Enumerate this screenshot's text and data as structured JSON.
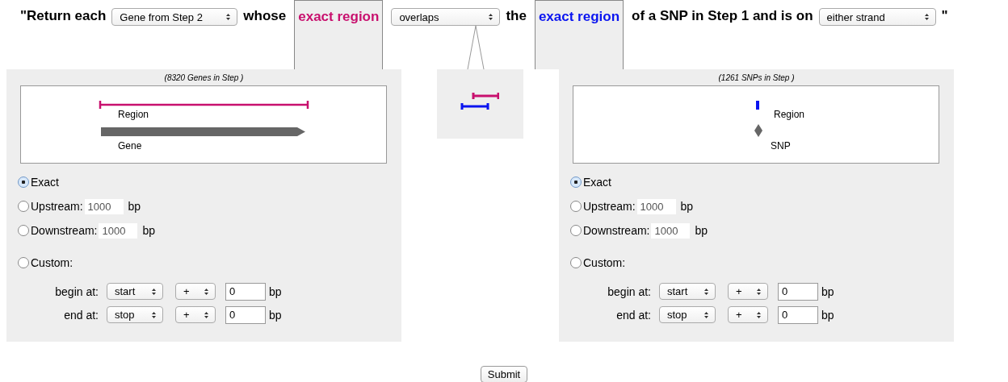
{
  "sentence": [
    {
      "kind": "text",
      "text": "\"Return each"
    },
    {
      "kind": "select",
      "value": "Gene from Step 2"
    },
    {
      "kind": "text",
      "text": "whose"
    },
    {
      "kind": "region",
      "text": "exact region",
      "color": "#c8106e"
    },
    {
      "kind": "select",
      "value": "overlaps"
    },
    {
      "kind": "text",
      "text": "the"
    },
    {
      "kind": "region",
      "text": "exact region",
      "color": "#0a14f0"
    },
    {
      "kind": "text",
      "text": "of a SNP in Step 1 and is on"
    },
    {
      "kind": "select",
      "value": "either strand"
    },
    {
      "kind": "text",
      "text": "\""
    }
  ],
  "panels": [
    {
      "count": "(8320 Genes in Step )",
      "diagram": {
        "kind": "gene",
        "labels": [
          "Region",
          "Gene"
        ]
      },
      "options": [
        {
          "kind": "exact",
          "label": "Exact",
          "selected": true
        },
        {
          "kind": "offset",
          "label": "Upstream:",
          "value": "1000",
          "unit": "bp",
          "selected": false
        },
        {
          "kind": "offset",
          "label": "Downstream:",
          "value": "1000",
          "unit": "bp",
          "selected": false
        },
        {
          "kind": "custom",
          "label": "Custom:",
          "selected": false
        }
      ],
      "custom_rows": [
        {
          "label": "begin at:",
          "anchor": "start",
          "sign": "+",
          "value": "0",
          "unit": "bp"
        },
        {
          "label": "end at:",
          "anchor": "stop",
          "sign": "+",
          "value": "0",
          "unit": "bp"
        }
      ]
    },
    {
      "count": "(1261 SNPs in Step )",
      "diagram": {
        "kind": "snp",
        "labels": [
          "Region",
          "SNP"
        ]
      },
      "options": [
        {
          "kind": "exact",
          "label": "Exact",
          "selected": true
        },
        {
          "kind": "offset",
          "label": "Upstream:",
          "value": "1000",
          "unit": "bp",
          "selected": false
        },
        {
          "kind": "offset",
          "label": "Downstream:",
          "value": "1000",
          "unit": "bp",
          "selected": false
        },
        {
          "kind": "custom",
          "label": "Custom:",
          "selected": false
        }
      ],
      "custom_rows": [
        {
          "label": "begin at:",
          "anchor": "start",
          "sign": "+",
          "value": "0",
          "unit": "bp"
        },
        {
          "label": "end at:",
          "anchor": "stop",
          "sign": "+",
          "value": "0",
          "unit": "bp"
        }
      ]
    }
  ],
  "submit": "Submit"
}
